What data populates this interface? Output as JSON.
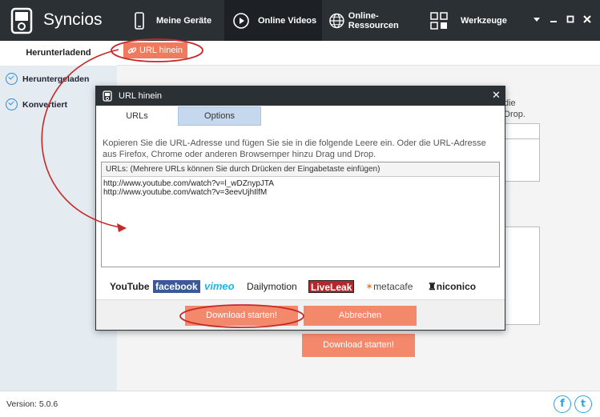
{
  "app": {
    "title": "Syncios"
  },
  "nav": {
    "devices": "Meine Geräte",
    "online_videos": "Online Videos",
    "online_resources": "Online-Ressourcen",
    "tools": "Werkzeuge"
  },
  "sidebar": {
    "downloading": "Herunterladend",
    "items": [
      {
        "label": "Heruntergeladen"
      },
      {
        "label": "Konvertiert"
      }
    ]
  },
  "toolbar": {
    "url_button": "URL hinein"
  },
  "background": {
    "text_fragment": "die\nDrop.",
    "download_button": "Download starten!"
  },
  "dialog": {
    "title": "URL hinein",
    "tabs": [
      {
        "label": "URLs"
      },
      {
        "label": "Options"
      }
    ],
    "description": "Kopieren Sie die URL-Adresse und fügen Sie sie in die folgende Leere ein. Oder die URL-Adresse aus Firefox, Chrome oder anderen Browsernper hinzu Drag und Drop.",
    "urls_label": "URLs: (Mehrere URLs können Sie durch Drücken der Eingabetaste einfügen)",
    "urls": [
      "http://www.youtube.com/watch?v=l_wDZnypJTA",
      "http://www.youtube.com/watch?v=3eevUjhIlfM"
    ],
    "logos": {
      "youtube": "YouTube",
      "facebook": "facebook",
      "vimeo": "vimeo",
      "dailymotion": "Dailymotion",
      "liveleak": "LiveLeak",
      "metacafe": "metacafe",
      "niconico": "niconico"
    },
    "start_button": "Download starten!",
    "cancel_button": "Abbrechen"
  },
  "footer": {
    "version": "Version: 5.0.6"
  },
  "colors": {
    "topbar": "#2b3035",
    "accent": "#f4886b",
    "annotation": "#d32f2f",
    "sidebar": "#e4ebf1",
    "social": "#2ba3dd"
  }
}
